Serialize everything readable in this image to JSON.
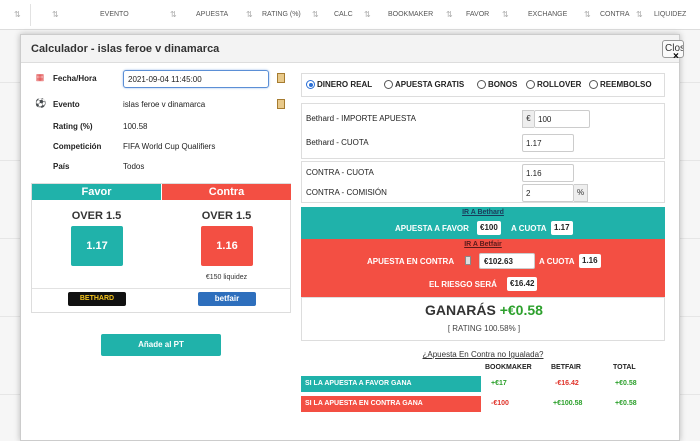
{
  "background_table": {
    "columns": [
      "EVENTO",
      "APUESTA",
      "RATING (%)",
      "CALC",
      "BOOKMAKER",
      "FAVOR",
      "EXCHANGE",
      "CONTRA",
      "LIQUIDEZ"
    ],
    "sort_icon": "sort-arrows-icon"
  },
  "modal": {
    "title": "Calculador - islas feroe v dinamarca",
    "close_label": "Close",
    "close_x": "×"
  },
  "info": {
    "fecha_label": "Fecha/Hora",
    "fecha_value": "2021-09-04 11:45:00",
    "evento_label": "Evento",
    "evento_value": "islas feroe v dinamarca",
    "rating_label": "Rating (%)",
    "rating_value": "100.58",
    "competicion_label": "Competición",
    "competicion_value": "FIFA World Cup Qualifiers",
    "pais_label": "País",
    "pais_value": "Todos"
  },
  "favor_contra": {
    "favor_header": "Favor",
    "contra_header": "Contra",
    "favor_market": "OVER 1.5",
    "contra_market": "OVER 1.5",
    "favor_odd": "1.17",
    "contra_odd": "1.16",
    "liquidez": "€150 liquidez",
    "favor_bookmaker": "BETHARD",
    "contra_exchange": "betfair",
    "colors": {
      "favor": "#20b2aa",
      "contra": "#f34f43"
    }
  },
  "add_pt_label": "Añade al PT",
  "modes": [
    {
      "label": "DINERO REAL",
      "selected": true
    },
    {
      "label": "APUESTA GRATIS",
      "selected": false
    },
    {
      "label": "BONOS",
      "selected": false
    },
    {
      "label": "ROLLOVER",
      "selected": false
    },
    {
      "label": "REEMBOLSO",
      "selected": false
    }
  ],
  "bookmaker_form": {
    "importe_label": "Bethard - IMPORTE APUESTA",
    "importe_prefix": "€",
    "importe_value": "100",
    "cuota_label": "Bethard - CUOTA",
    "cuota_value": "1.17"
  },
  "exchange_form": {
    "contra_cuota_label": "CONTRA - CUOTA",
    "contra_cuota_value": "1.16",
    "comision_label": "CONTRA - COMISIÓN",
    "comision_value": "2",
    "comision_suffix": "%"
  },
  "favor_block": {
    "link": "IR A Bethard",
    "apuesta_label": "APUESTA A FAVOR",
    "apuesta_value": "€100",
    "cuota_label": "A CUOTA",
    "cuota_value": "1.17"
  },
  "contra_block": {
    "link": "IR A Betfair",
    "apuesta_label": "APUESTA EN CONTRA",
    "apuesta_value": "€102.63",
    "cuota_label": "A CUOTA",
    "cuota_value": "1.16",
    "riesgo_label": "EL RIESGO SERÁ",
    "riesgo_value": "€16.42"
  },
  "result": {
    "ganaras_label": "GANARÁS",
    "ganaras_value": "+€0.58",
    "rating_line": "[ RATING 100.58% ]"
  },
  "uneven_link": "¿Apuesta En Contra no Igualada?",
  "outcomes": {
    "headers": [
      "BOOKMAKER",
      "BETFAIR",
      "TOTAL"
    ],
    "rows": [
      {
        "label": "SI LA APUESTA A FAVOR GANA",
        "bookmaker": "+€17",
        "betfair": "-€16.42",
        "total": "+€0.58"
      },
      {
        "label": "SI LA APUESTA EN CONTRA GANA",
        "bookmaker": "-€100",
        "betfair": "+€100.58",
        "total": "+€0.58"
      }
    ]
  }
}
